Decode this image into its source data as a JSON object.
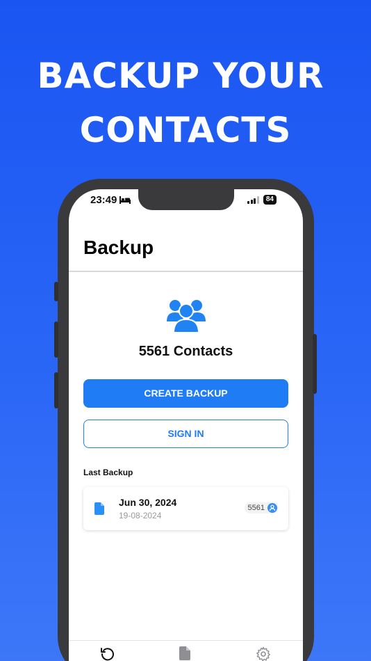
{
  "headline": {
    "line1": "BACKUP YOUR",
    "line2": "CONTACTS"
  },
  "status_bar": {
    "time": "23:49",
    "battery": "84"
  },
  "app": {
    "title": "Backup",
    "contacts_count_label": "5561 Contacts",
    "create_backup_label": "CREATE BACKUP",
    "sign_in_label": "SIGN IN",
    "last_backup_heading": "Last Backup",
    "last_backup": {
      "date": "Jun 30, 2024",
      "subdate": "19-08-2024",
      "count": "5561"
    }
  },
  "tabs": [
    {
      "icon": "history-icon"
    },
    {
      "icon": "document-icon"
    },
    {
      "icon": "gear-icon"
    }
  ],
  "colors": {
    "background": "#1a55f2",
    "accent": "#1f7cf5",
    "phone_frame": "#3a3a3c"
  }
}
